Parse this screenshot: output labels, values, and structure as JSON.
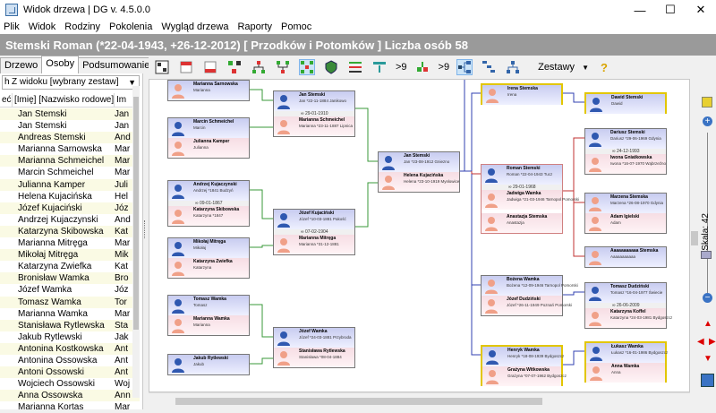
{
  "window": {
    "title": "Widok drzewa | DG v. 4.5.0.0",
    "min_label": "—",
    "max_label": "☐",
    "close_label": "✕"
  },
  "menu": [
    "Plik",
    "Widok",
    "Rodziny",
    "Pokolenia",
    "Wygląd drzewa",
    "Raporty",
    "Pomoc"
  ],
  "header": {
    "title": "Stemski Roman  (*22-04-1943, +26-12-2012) [ Przodków i Potomków ] Liczba osób 58"
  },
  "tabs": [
    "Drzewo",
    "Osoby",
    "Podsumowanie"
  ],
  "left": {
    "filter_prefix": "h",
    "filter_value": "Z widoku [wybrany zestaw]",
    "columns": [
      "eć",
      "[Imię] [Nazwisko rodowe]",
      "Im"
    ],
    "rows": [
      {
        "name": "Jan Stemski",
        "short": "Jan"
      },
      {
        "name": "Jan Stemski",
        "short": "Jan"
      },
      {
        "name": "Andreas Stemski",
        "short": "And"
      },
      {
        "name": "Marianna Sarnowska",
        "short": "Mar"
      },
      {
        "name": "Marianna Schmeichel",
        "short": "Mar"
      },
      {
        "name": "Marcin Schmeichel",
        "short": "Mar"
      },
      {
        "name": "Julianna Kamper",
        "short": "Juli"
      },
      {
        "name": "Helena Kujacińska",
        "short": "Hel"
      },
      {
        "name": "Józef Kujaciński",
        "short": "Józ"
      },
      {
        "name": "Andrzej Kujaczynski",
        "short": "And"
      },
      {
        "name": "Katarzyna Skibowska",
        "short": "Kat"
      },
      {
        "name": "Marianna Mitręga",
        "short": "Mar"
      },
      {
        "name": "Mikołaj Mitręga",
        "short": "Mik"
      },
      {
        "name": "Katarzyna Zwiefka",
        "short": "Kat"
      },
      {
        "name": "Bronisław Wamka",
        "short": "Bro"
      },
      {
        "name": "Józef Wamka",
        "short": "Józ"
      },
      {
        "name": "Tomasz Wamka",
        "short": "Tor"
      },
      {
        "name": "Marianna Wamka",
        "short": "Mar"
      },
      {
        "name": "Stanisława Rytlewska",
        "short": "Sta"
      },
      {
        "name": "Jakub Rytlewski",
        "short": "Jak"
      },
      {
        "name": "Antonina Kostkowska",
        "short": "Ant"
      },
      {
        "name": "Antonina Ossowska",
        "short": "Ant"
      },
      {
        "name": "Antoni Ossowski",
        "short": "Ant"
      },
      {
        "name": "Wojciech Ossowski",
        "short": "Woj"
      },
      {
        "name": "Anna Ossowska",
        "short": "Ann"
      },
      {
        "name": "Marianna Kortas",
        "short": "Mar"
      }
    ]
  },
  "toolbar": {
    "gen_up": ">9",
    "gen_down": ">9",
    "sets_label": "Zestawy",
    "help": "?"
  },
  "zoom": {
    "label": "Skala: 42",
    "level_percent": 42
  },
  "tree": {
    "col1": [
      {
        "top": {
          "name": "Marianna Sarnowska",
          "info": "Marianna"
        }
      },
      {
        "top": {
          "name": "Marcin Schmeichel",
          "info": "Marcin"
        },
        "bottom": {
          "name": "Julianna Kamper",
          "info": "Julianna"
        }
      },
      {
        "top": {
          "name": "Andrzej Kujaczynski",
          "info": "Andrzej  *1841 Budzyń"
        },
        "marriage": "∞ 09-01-1867",
        "bottom": {
          "name": "Katarzyna Skibowska",
          "info": "Katarzyna  *1847"
        }
      },
      {
        "top": {
          "name": "Mikołaj Mitręga",
          "info": "Mikołaj"
        },
        "bottom": {
          "name": "Katarzyna Zwiefka",
          "info": "Katarzyna"
        }
      },
      {
        "top": {
          "name": "Tomasz Wamka",
          "info": "Tomasz"
        },
        "bottom": {
          "name": "Marianna Wamka",
          "info": "Marianna"
        }
      },
      {
        "top": {
          "name": "Jakub Rytlewski",
          "info": "Jakub"
        }
      }
    ],
    "col2": [
      {
        "top": {
          "name": "Jan Stemski",
          "info": "Jan  *22-11-1884 Janikowo"
        },
        "marriage": "∞ 29-01-1910",
        "bottom": {
          "name": "Marianna Schmeichel",
          "info": "Marianna  *23-11-1887 Lipnica"
        }
      },
      {
        "top": {
          "name": "Józef Kujaciński",
          "info": "Józef  *10-03-1881 Pakość"
        },
        "marriage": "∞ 07-02-1904",
        "bottom": {
          "name": "Marianna Mitręga",
          "info": "Marianna  *31-12-1881"
        }
      },
      {
        "top": {
          "name": "Józef Wamka",
          "info": "Józef  *24-03-1881 Przybroda"
        },
        "bottom": {
          "name": "Stanisława Rytlewska",
          "info": "Stanisława  *08-04-1884"
        }
      }
    ],
    "col3": [
      {
        "top": {
          "name": "Jan Stemski",
          "info": "Jan  *23-08-1912 Gniezno"
        },
        "bottom": {
          "name": "Helena Kujacińska",
          "info": "Helena  *23-10-1919 Mysłowice"
        }
      }
    ],
    "col4": [
      {
        "top": {
          "name": "Irena Stemska",
          "info": "Irena"
        }
      },
      {
        "top": {
          "name": "Roman Stemski",
          "info": "Roman  *22-04-1943 Tucz"
        },
        "bottom": {
          "name": "Jadwiga Wamka",
          "info": "Jadwiga  *21-03-1946 Tarnopol Pomorski"
        },
        "marriage": "∞ 29-01-1968",
        "extra": {
          "name": "Anastazja Stemska",
          "info": "Anastazja"
        }
      },
      {
        "top": {
          "name": "Bożena Wamka",
          "info": "Bożena  *12-09-1946 Tarnopol Pomorski"
        },
        "bottom": {
          "name": "Józef Dudziński",
          "info": "Józef  *26-11-1949 Poznań Pomorski"
        }
      },
      {
        "top": {
          "name": "Henryk Wamka",
          "info": "Henryk  *18-08-1939 Bydgoszcz"
        },
        "bottom": {
          "name": "Grażyna Witkowska",
          "info": "Grażyna  *07-07-1962 Bydgoszcz"
        }
      }
    ],
    "col5": [
      {
        "top": {
          "name": "Dawid Stemski",
          "info": "Dawid"
        }
      },
      {
        "top": {
          "name": "Dariusz Stemski",
          "info": "Dariusz  *29-06-1969 Gdynia"
        },
        "bottom": {
          "name": "Iwona Gniatkowska",
          "info": "Iwona  *16-07-1970 Wąbrzeźno"
        },
        "marriage": "∞ 24-12-1993"
      },
      {
        "top": {
          "name": "Marzena Stemska",
          "info": "Marzena  *26-08-1970 Gdynia"
        },
        "bottom": {
          "name": "Adam Igielski",
          "info": "Adam"
        }
      },
      {
        "top": {
          "name": "Aaaaaaaaaaa Stemska",
          "info": "Aaaaaaaaaaa"
        }
      },
      {
        "top": {
          "name": "Tomasz Dudziński",
          "info": "Tomasz  *16-04-1977 Świecie"
        },
        "bottom": {
          "name": "Katarzyna Koffel",
          "info": "Katarzyna  *24-03-1981 Bydgoszcz"
        },
        "marriage": "∞ 26-06-2009"
      },
      {
        "top": {
          "name": "Łukasz Wamka",
          "info": "Łukasz  *16-01-1986 Bydgoszcz"
        },
        "bottom": {
          "name": "Anna Wamka",
          "info": "Anna"
        }
      }
    ]
  },
  "colors": {
    "male": "#c8ccf0",
    "female": "#f6dde4",
    "header_bg": "#9a9a9a",
    "line_green": "#3a9a3a",
    "line_red": "#c03030",
    "line_blue": "#3040b0",
    "highlight": "#e2c600"
  }
}
